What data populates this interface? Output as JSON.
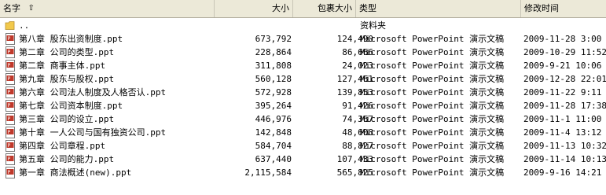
{
  "header": {
    "name": "名字",
    "size": "大小",
    "packed": "包裹大小",
    "type": "类型",
    "modified": "修改时间"
  },
  "colors": {
    "header_bg": "#ece9d8",
    "folder": "#f2c94c",
    "ppt": "#c0392b"
  },
  "rows": [
    {
      "icon": "folder-up-icon",
      "name": "..",
      "size": "",
      "packed": "",
      "type": "资料夹",
      "modified": ""
    },
    {
      "icon": "ppt-file-icon",
      "name": "第八章  股东出资制度.ppt",
      "size": "673,792",
      "packed": "124,490",
      "type": "Microsoft PowerPoint 演示文稿",
      "modified": "2009-11-28 3:00"
    },
    {
      "icon": "ppt-file-icon",
      "name": "第二章  公司的类型.ppt",
      "size": "228,864",
      "packed": "86,666",
      "type": "Microsoft PowerPoint 演示文稿",
      "modified": "2009-10-29 11:52"
    },
    {
      "icon": "ppt-file-icon",
      "name": "第二章  商事主体.ppt",
      "size": "311,808",
      "packed": "24,023",
      "type": "Microsoft PowerPoint 演示文稿",
      "modified": "2009-9-21 10:06"
    },
    {
      "icon": "ppt-file-icon",
      "name": "第九章  股东与股权.ppt",
      "size": "560,128",
      "packed": "127,461",
      "type": "Microsoft PowerPoint 演示文稿",
      "modified": "2009-12-28 22:01"
    },
    {
      "icon": "ppt-file-icon",
      "name": "第六章  公司法人制度及人格否认.ppt",
      "size": "572,928",
      "packed": "139,853",
      "type": "Microsoft PowerPoint 演示文稿",
      "modified": "2009-11-22 9:11"
    },
    {
      "icon": "ppt-file-icon",
      "name": "第七章  公司资本制度.ppt",
      "size": "395,264",
      "packed": "91,426",
      "type": "Microsoft PowerPoint 演示文稿",
      "modified": "2009-11-28 17:38"
    },
    {
      "icon": "ppt-file-icon",
      "name": "第三章  公司的设立.ppt",
      "size": "446,976",
      "packed": "74,367",
      "type": "Microsoft PowerPoint 演示文稿",
      "modified": "2009-11-1 11:00"
    },
    {
      "icon": "ppt-file-icon",
      "name": "第十章  一人公司与国有独资公司.ppt",
      "size": "142,848",
      "packed": "48,608",
      "type": "Microsoft PowerPoint 演示文稿",
      "modified": "2009-11-4 13:12"
    },
    {
      "icon": "ppt-file-icon",
      "name": "第四章  公司章程.ppt",
      "size": "584,704",
      "packed": "88,827",
      "type": "Microsoft PowerPoint 演示文稿",
      "modified": "2009-11-13 10:32"
    },
    {
      "icon": "ppt-file-icon",
      "name": "第五章  公司的能力.ppt",
      "size": "637,440",
      "packed": "107,433",
      "type": "Microsoft PowerPoint 演示文稿",
      "modified": "2009-11-14 10:13"
    },
    {
      "icon": "ppt-file-icon",
      "name": "第一章  商法概述(new).ppt",
      "size": "2,115,584",
      "packed": "565,825",
      "type": "Microsoft PowerPoint 演示文稿",
      "modified": "2009-9-16 14:21"
    }
  ]
}
